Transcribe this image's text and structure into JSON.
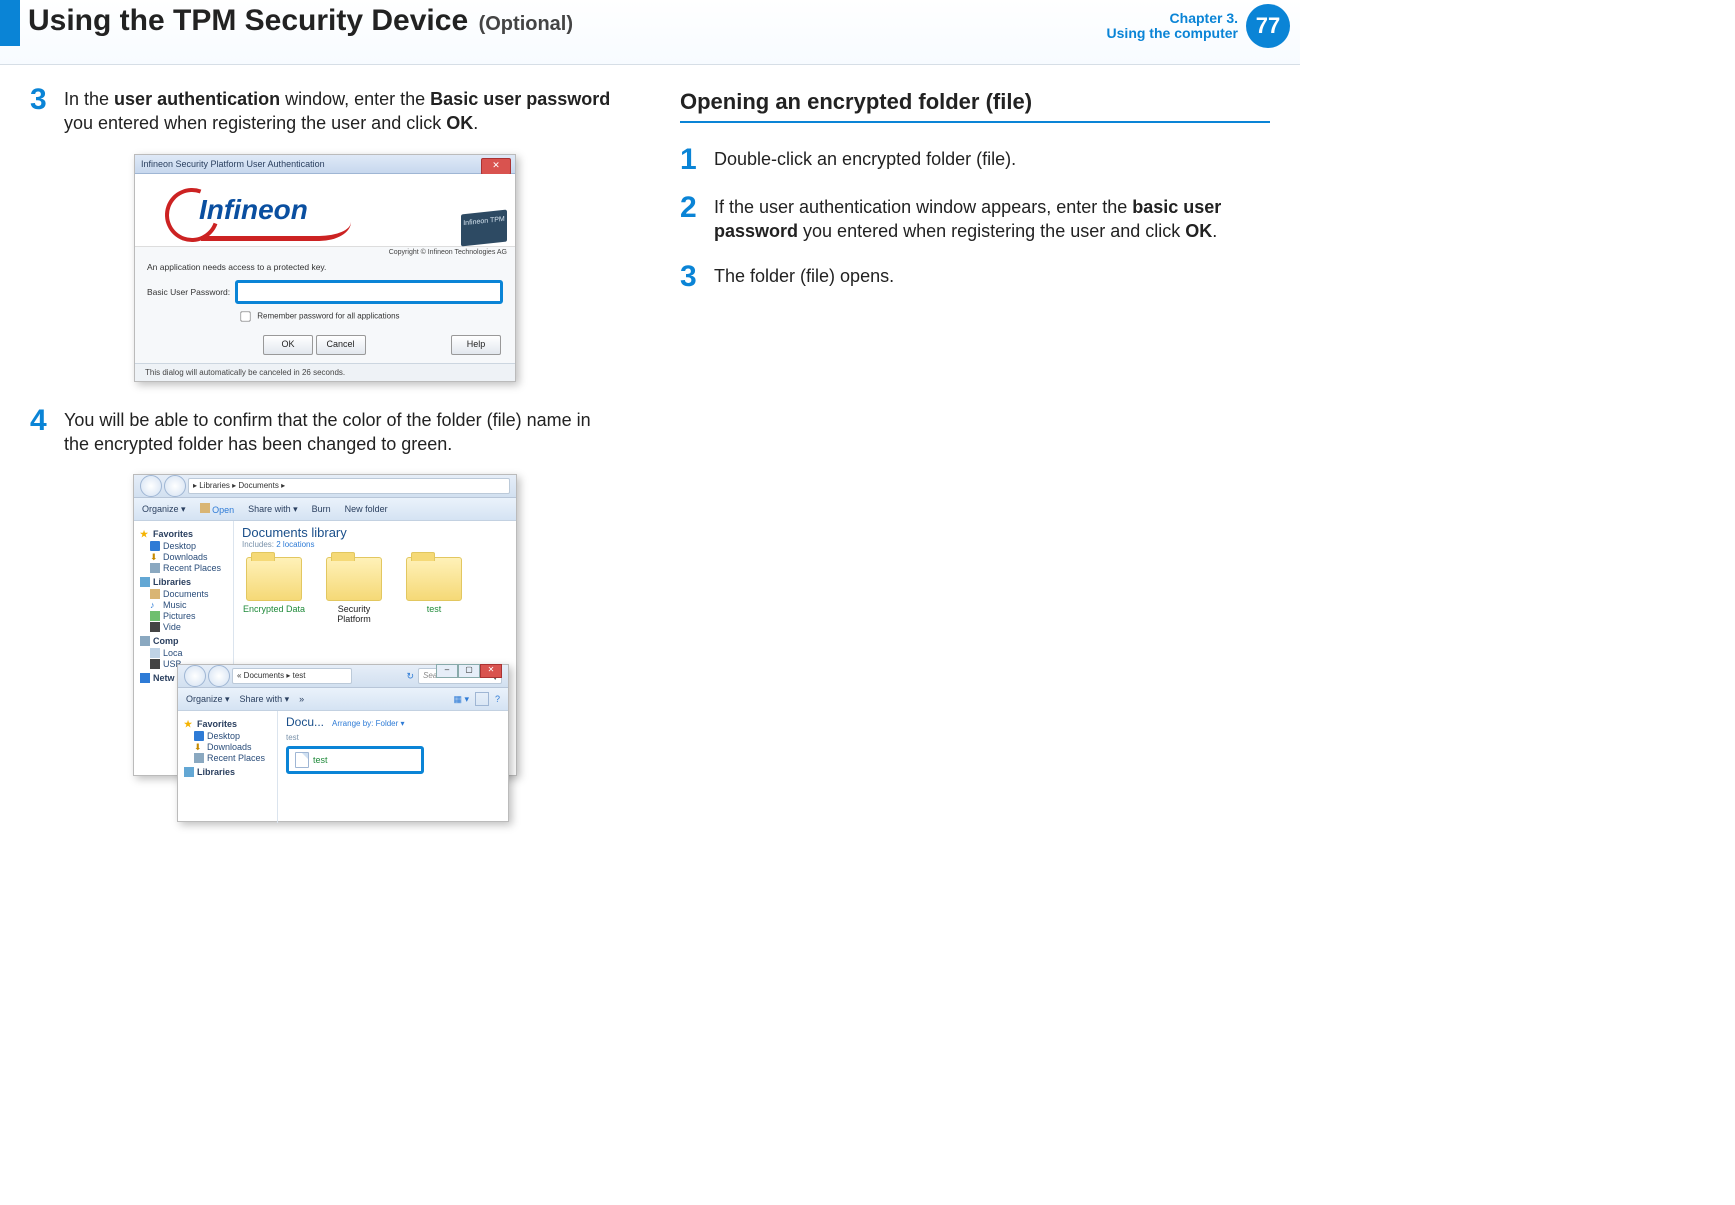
{
  "header": {
    "title": "Using the TPM Security Device",
    "subtitle": "(Optional)",
    "chapter_line1": "Chapter 3.",
    "chapter_line2": "Using the computer",
    "page_number": "77"
  },
  "left_col": {
    "step3": {
      "num": "3",
      "pre": "In the ",
      "b1": "user authentication",
      "mid1": " window, enter the ",
      "b2": "Basic user password",
      "mid2": " you entered when registering the user and click ",
      "b3": "OK",
      "end": "."
    },
    "auth_dialog": {
      "title": "Infineon Security Platform User Authentication",
      "logo_text": "Infineon",
      "chip_text": "Infineon TPM",
      "copyright": "Copyright © Infineon Technologies AG",
      "instruction": "An application needs access to a protected key.",
      "label_password": "Basic User Password:",
      "remember": "Remember password for all applications",
      "btn_ok": "OK",
      "btn_cancel": "Cancel",
      "btn_help": "Help",
      "footer": "This dialog will automatically be canceled in 26 seconds."
    },
    "step4": {
      "num": "4",
      "text": "You will be able to confirm that the color of the folder (file) name in the encrypted folder has been changed to green."
    },
    "explorer_a": {
      "breadcrumb": "▸ Libraries ▸ Documents ▸",
      "toolbar": {
        "organize": "Organize ▾",
        "open": "Open",
        "share": "Share with ▾",
        "burn": "Burn",
        "newfolder": "New folder"
      },
      "nav": {
        "favorites": "Favorites",
        "desktop": "Desktop",
        "downloads": "Downloads",
        "recent": "Recent Places",
        "libraries": "Libraries",
        "documents": "Documents",
        "music": "Music",
        "pictures": "Pictures",
        "videos": "Vide",
        "computer": "Comp",
        "local": "Loca",
        "usb": "USB",
        "network": "Netw"
      },
      "library_title": "Documents library",
      "library_sub_prefix": "Includes: ",
      "library_sub_link": "2 locations",
      "folders": {
        "f1": "Encrypted Data",
        "f2": "Security Platform",
        "f3": "test"
      }
    },
    "explorer_b": {
      "breadcrumb": "« Documents ▸ test",
      "search_placeholder": "Search test",
      "toolbar": {
        "organize": "Organize ▾",
        "share": "Share with ▾",
        "more": "»"
      },
      "nav": {
        "favorites": "Favorites",
        "desktop": "Desktop",
        "downloads": "Downloads",
        "recent": "Recent Places",
        "libraries": "Libraries"
      },
      "content": {
        "title": "Docu...",
        "subtitle": "test",
        "arrange_label": "Arrange by:",
        "arrange_value": "Folder ▾",
        "file_name": "test"
      }
    }
  },
  "right_col": {
    "section_title": "Opening an encrypted folder (file)",
    "step1": {
      "num": "1",
      "text": "Double-click an encrypted folder (file)."
    },
    "step2": {
      "num": "2",
      "pre": "If the user authentication window appears, enter the ",
      "b1": "basic user password",
      "mid": " you entered when registering the user and click ",
      "b2": "OK",
      "end": "."
    },
    "step3": {
      "num": "3",
      "text": "The folder (file) opens."
    }
  }
}
